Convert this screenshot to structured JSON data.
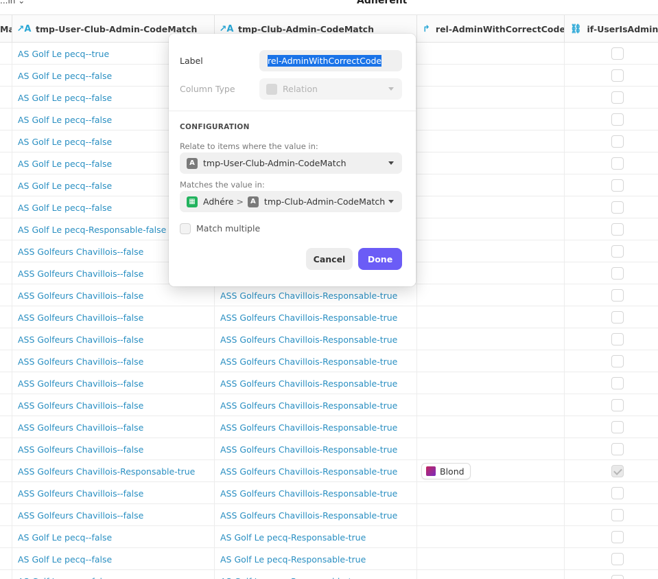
{
  "top": {
    "left_text": "...in ⌄",
    "title": "Adherent"
  },
  "columns": [
    {
      "label": "Ma",
      "icon": "text-icon"
    },
    {
      "label": "tmp-User-Club-Admin-CodeMatch",
      "icon": "computed-text-icon"
    },
    {
      "label": "tmp-Club-Admin-CodeMatch",
      "icon": "computed-text-icon"
    },
    {
      "label": "rel-AdminWithCorrectCode",
      "icon": "relation-icon"
    },
    {
      "label": "if-UserIsAdmin",
      "icon": "if-then-icon"
    }
  ],
  "rows": [
    {
      "c1": "AS  Golf Le pecq--true",
      "c2": "",
      "c3": "",
      "checked": false
    },
    {
      "c1": "AS Golf Le pecq--false",
      "c2": "",
      "c3": "",
      "checked": false
    },
    {
      "c1": "AS Golf Le pecq--false",
      "c2": "",
      "c3": "",
      "checked": false
    },
    {
      "c1": "AS Golf Le pecq--false",
      "c2": "",
      "c3": "",
      "checked": false
    },
    {
      "c1": "AS Golf Le pecq--false",
      "c2": "",
      "c3": "",
      "checked": false
    },
    {
      "c1": "AS Golf Le pecq--false",
      "c2": "",
      "c3": "",
      "checked": false
    },
    {
      "c1": "AS Golf Le pecq--false",
      "c2": "",
      "c3": "",
      "checked": false
    },
    {
      "c1": "AS Golf Le pecq--false",
      "c2": "",
      "c3": "",
      "checked": false
    },
    {
      "c1": "AS Golf Le pecq-Responsable-false",
      "c2": "",
      "c3": "",
      "checked": false
    },
    {
      "c1": "ASS Golfeurs Chavillois--false",
      "c2": "",
      "c3": "",
      "checked": false
    },
    {
      "c1": "ASS Golfeurs Chavillois--false",
      "c2": "",
      "c3": "",
      "checked": false
    },
    {
      "c1": "ASS Golfeurs Chavillois--false",
      "c2": "ASS Golfeurs Chavillois-Responsable-true",
      "c3": "",
      "checked": false
    },
    {
      "c1": "ASS Golfeurs Chavillois--false",
      "c2": "ASS Golfeurs Chavillois-Responsable-true",
      "c3": "",
      "checked": false
    },
    {
      "c1": "ASS Golfeurs Chavillois--false",
      "c2": "ASS Golfeurs Chavillois-Responsable-true",
      "c3": "",
      "checked": false
    },
    {
      "c1": "ASS Golfeurs Chavillois--false",
      "c2": "ASS Golfeurs Chavillois-Responsable-true",
      "c3": "",
      "checked": false
    },
    {
      "c1": "ASS Golfeurs Chavillois--false",
      "c2": "ASS Golfeurs Chavillois-Responsable-true",
      "c3": "",
      "checked": false
    },
    {
      "c1": "ASS Golfeurs Chavillois--false",
      "c2": "ASS Golfeurs Chavillois-Responsable-true",
      "c3": "",
      "checked": false
    },
    {
      "c1": "ASS Golfeurs Chavillois--false",
      "c2": "ASS Golfeurs Chavillois-Responsable-true",
      "c3": "",
      "checked": false
    },
    {
      "c1": "ASS Golfeurs Chavillois--false",
      "c2": "ASS Golfeurs Chavillois-Responsable-true",
      "c3": "",
      "checked": false
    },
    {
      "c1": "ASS Golfeurs Chavillois-Responsable-true",
      "c2": "ASS Golfeurs Chavillois-Responsable-true",
      "c3": "Blond",
      "checked": true
    },
    {
      "c1": "ASS Golfeurs Chavillois--false",
      "c2": "ASS Golfeurs Chavillois-Responsable-true",
      "c3": "",
      "checked": false
    },
    {
      "c1": "ASS Golfeurs Chavillois--false",
      "c2": "ASS Golfeurs Chavillois-Responsable-true",
      "c3": "",
      "checked": false
    },
    {
      "c1": "AS Golf Le pecq--false",
      "c2": "AS Golf Le pecq-Responsable-true",
      "c3": "",
      "checked": false
    },
    {
      "c1": "AS Golf Le pecq--false",
      "c2": "AS Golf Le pecq-Responsable-true",
      "c3": "",
      "checked": false
    },
    {
      "c1": "AS Golf Le pecq--false",
      "c2": "AS Golf Le pecq-Responsable-true",
      "c3": "",
      "checked": false
    }
  ],
  "popover": {
    "label_title": "Label",
    "label_value": "rel-AdminWithCorrectCode",
    "column_type_title": "Column Type",
    "column_type_value": "Relation",
    "configuration": "CONFIGURATION",
    "relate_label": "Relate to items where the value in:",
    "relate_value": "tmp-User-Club-Admin-CodeMatch",
    "matches_label": "Matches the value in:",
    "matches_table": "Adhére",
    "matches_separator": ">",
    "matches_value": "tmp-Club-Admin-CodeMatch",
    "match_multiple": "Match multiple",
    "cancel": "Cancel",
    "done": "Done"
  },
  "colors": {
    "accent": "#6b5cf6",
    "link_text": "#2a8fc2",
    "selection": "#1a73e8"
  }
}
